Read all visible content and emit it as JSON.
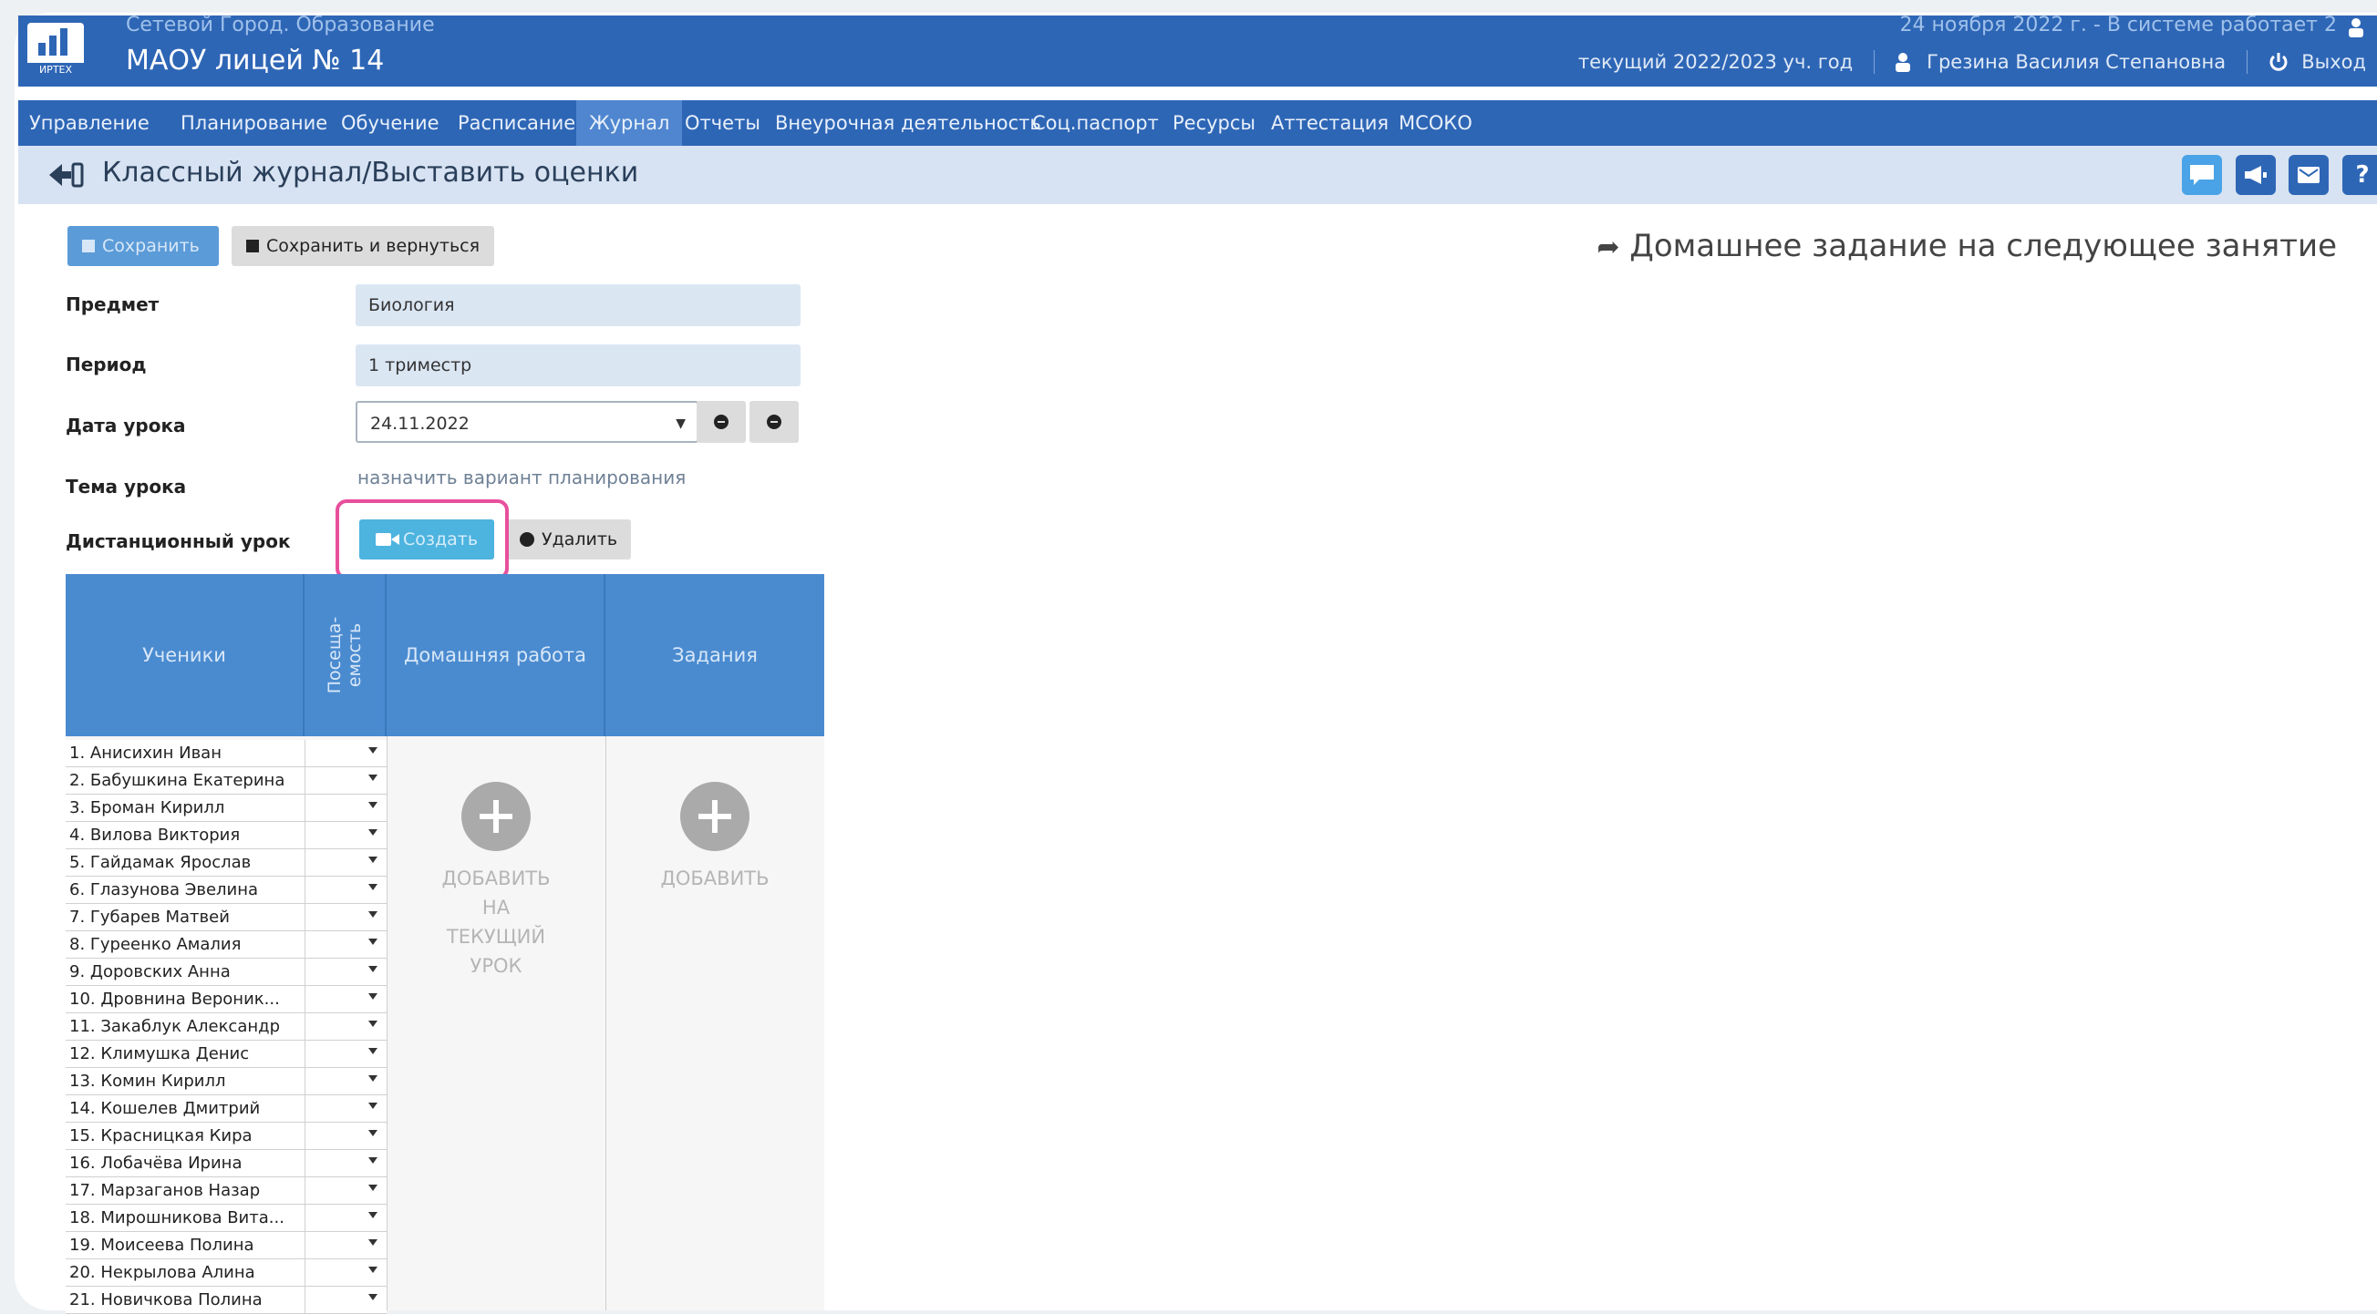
{
  "header": {
    "logo_text": "ИРТЕХ",
    "network_name": "Сетевой Город. Образование",
    "school_name": "МАОУ лицей № 14",
    "datetime": "24 ноября 2022 г. - В системе работает 2",
    "school_year": "текущий 2022/2023 уч. год",
    "user_name": "Грезина Василия Степановна",
    "logout_label": "Выход"
  },
  "menu": {
    "items": [
      "Управление",
      "Планирование",
      "Обучение",
      "Расписание",
      "Журнал",
      "Отчеты",
      "Внеурочная деятельность",
      "Соц.паспорт",
      "Ресурсы",
      "Аттестация",
      "МСОКО"
    ],
    "active": "Журнал"
  },
  "titlebar": {
    "title": "Классный журнал/Выставить оценки",
    "help_label": "?"
  },
  "toolbar": {
    "save_label": "Сохранить",
    "save_return_label": "Сохранить и вернуться",
    "homework_next_label": "Домашнее задание на следующее занятие"
  },
  "form": {
    "subject_label": "Предмет",
    "subject_value": "Биология",
    "period_label": "Период",
    "period_value": "1 триместр",
    "date_label": "Дата урока",
    "date_value": "24.11.2022",
    "topic_label": "Тема урока",
    "topic_link": "назначить вариант планирования",
    "remote_label": "Дистанционный урок",
    "create_label": "Создать",
    "delete_label": "Удалить"
  },
  "table": {
    "col_students": "Ученики",
    "col_attendance": "Посеща-\nемость",
    "col_homework": "Домашняя работа",
    "col_tasks": "Задания",
    "add_homework": "ДОБАВИТЬ\nНА\nТЕКУЩИЙ\nУРОК",
    "add_tasks": "ДОБАВИТЬ",
    "students": [
      "1. Анисихин Иван",
      "2. Бабушкина Екатерина",
      "3. Броман Кирилл",
      "4. Вилова Виктория",
      "5. Гайдамак Ярослав",
      "6. Глазунова Эвелина",
      "7. Губарев Матвей",
      "8. Гуреенко Амалия",
      "9. Доровских Анна",
      "10. Дровнина Вероник...",
      "11. Закаблук Александр",
      "12. Климушка Денис",
      "13. Комин Кирилл",
      "14. Кошелев Дмитрий",
      "15. Красницкая Кира",
      "16. Лобачёва Ирина",
      "17. Марзаганов Назар",
      "18. Мирошникова Вита...",
      "19. Моисеева Полина",
      "20. Некрылова Алина",
      "21. Новичкова Полина"
    ]
  },
  "colors": {
    "header_bg": "#2e66b6",
    "titlebar_bg": "#d7e3f2",
    "table_header_bg": "#4a8bd0",
    "highlight": "#e84f9c"
  }
}
